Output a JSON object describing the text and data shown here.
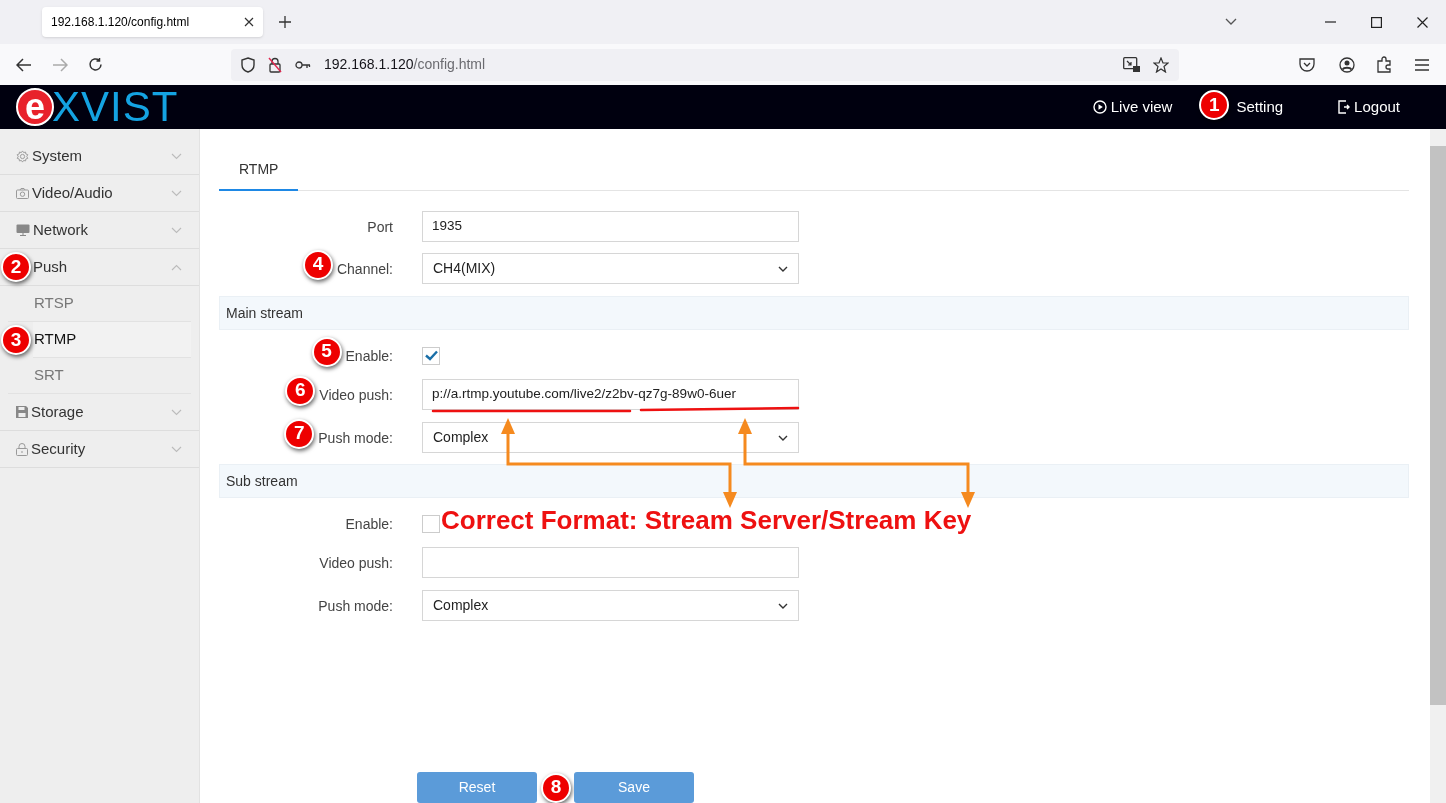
{
  "browser": {
    "tab_title": "192.168.1.120/config.html",
    "url_host": "192.168.1.120",
    "url_path": "/config.html"
  },
  "header": {
    "logo": {
      "mark": "e",
      "text": "XVIST"
    },
    "nav": [
      {
        "label": "Live view",
        "kind": "play"
      },
      {
        "label": "Setting",
        "badge": "1"
      },
      {
        "label": "Logout",
        "kind": "logout"
      }
    ]
  },
  "sidebar": {
    "items": [
      {
        "label": "System",
        "kind": "gear",
        "expanded": false
      },
      {
        "label": "Video/Audio",
        "kind": "camera",
        "expanded": false
      },
      {
        "label": "Network",
        "kind": "monitor",
        "expanded": false
      },
      {
        "label": "Push",
        "badge": "2",
        "expanded": true,
        "children": [
          {
            "label": "RTSP",
            "selected": false
          },
          {
            "label": "RTMP",
            "selected": true,
            "badge": "3"
          },
          {
            "label": "SRT",
            "selected": false
          }
        ]
      },
      {
        "label": "Storage",
        "kind": "floppy",
        "expanded": false
      },
      {
        "label": "Security",
        "kind": "lock",
        "expanded": false
      }
    ]
  },
  "tabs": [
    {
      "label": "RTMP",
      "selected": true
    }
  ],
  "form": {
    "fields": [
      {
        "kind": "text",
        "label": "Port",
        "value": "1935"
      },
      {
        "kind": "select",
        "label": "Channel:",
        "value": "CH4(MIX)",
        "badge": "4"
      }
    ],
    "sections": [
      {
        "title": "Main stream",
        "fields": [
          {
            "kind": "checkbox",
            "label": "Enable:",
            "checked": true,
            "badge": "5"
          },
          {
            "kind": "text",
            "label": "Video push:",
            "value": "p://a.rtmp.youtube.com/live2/z2bv-qz7g-89w0-6uer",
            "badge": "6"
          },
          {
            "kind": "select",
            "label": "Push mode:",
            "value": "Complex",
            "badge": "7"
          }
        ]
      },
      {
        "title": "Sub stream",
        "fields": [
          {
            "kind": "checkbox",
            "label": "Enable:",
            "checked": false
          },
          {
            "kind": "text",
            "label": "Video push:"
          },
          {
            "kind": "select",
            "label": "Push mode:",
            "value": "Complex"
          }
        ]
      }
    ]
  },
  "buttons": [
    {
      "label": "Reset"
    },
    {
      "label": "Save",
      "badge": "8"
    }
  ],
  "annotation": {
    "caption": "Correct Format: Stream Server/Stream Key"
  }
}
